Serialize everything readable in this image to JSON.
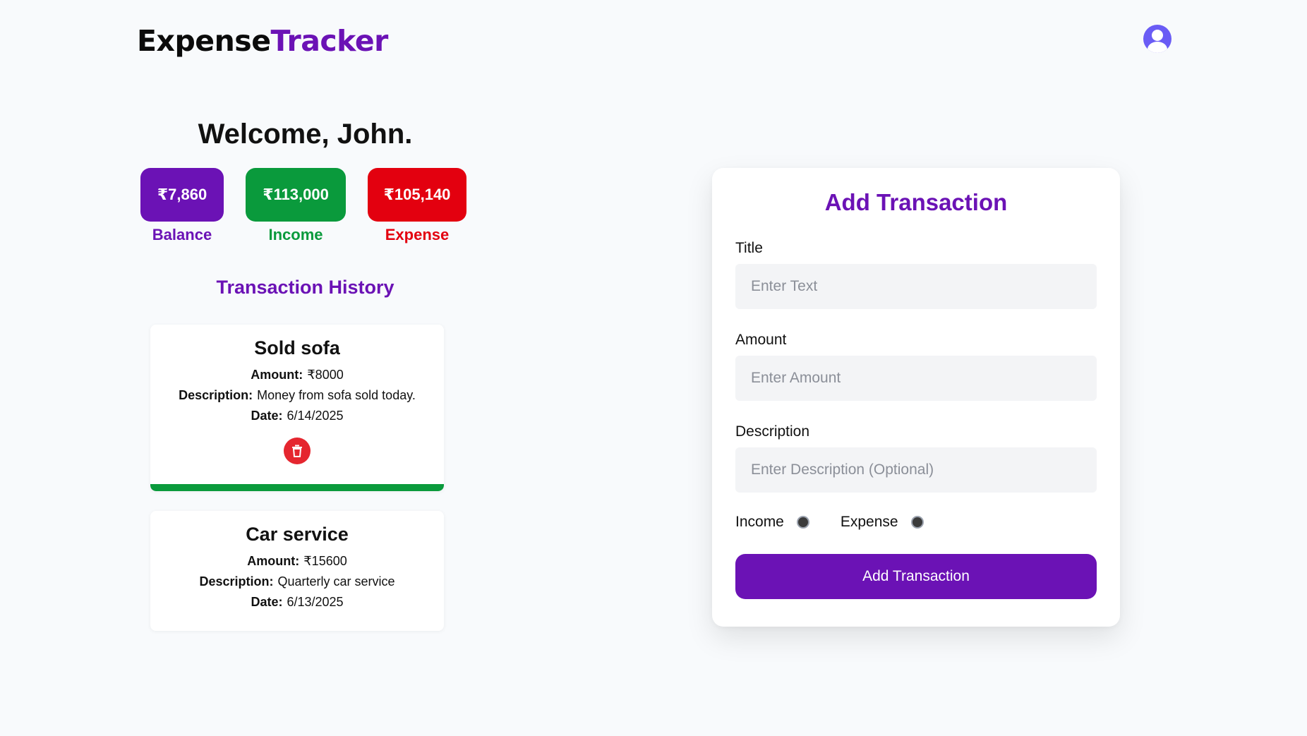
{
  "header": {
    "logo_part1": "Expense",
    "logo_part2": "Tracker",
    "avatar_icon": "user-avatar-icon"
  },
  "welcome": "Welcome, John.",
  "stats": [
    {
      "value": "₹7,860",
      "label": "Balance",
      "color": "#6b12b5"
    },
    {
      "value": "₹113,000",
      "label": "Income",
      "color": "#0a9a3c"
    },
    {
      "value": "₹105,140",
      "label": "Expense",
      "color": "#e3000f"
    }
  ],
  "history": {
    "title": "Transaction History",
    "transactions": [
      {
        "title": "Sold sofa",
        "amount_label": "Amount:",
        "amount": "₹8000",
        "description_label": "Description:",
        "description": "Money from sofa sold today.",
        "date_label": "Date:",
        "date": "6/14/2025",
        "type_color": "#0a9a3c",
        "delete_icon": "trash-icon"
      },
      {
        "title": "Car service",
        "amount_label": "Amount:",
        "amount": "₹15600",
        "description_label": "Description:",
        "description": "Quarterly car service",
        "date_label": "Date:",
        "date": "6/13/2025"
      }
    ]
  },
  "form": {
    "title": "Add Transaction",
    "title_label": "Title",
    "title_placeholder": "Enter Text",
    "amount_label": "Amount",
    "amount_placeholder": "Enter Amount",
    "description_label": "Description",
    "description_placeholder": "Enter Description (Optional)",
    "income_option": "Income",
    "expense_option": "Expense",
    "submit_label": "Add Transaction"
  },
  "colors": {
    "accent": "#6b12b5",
    "income": "#0a9a3c",
    "expense": "#e3000f",
    "delete": "#e5262f"
  }
}
